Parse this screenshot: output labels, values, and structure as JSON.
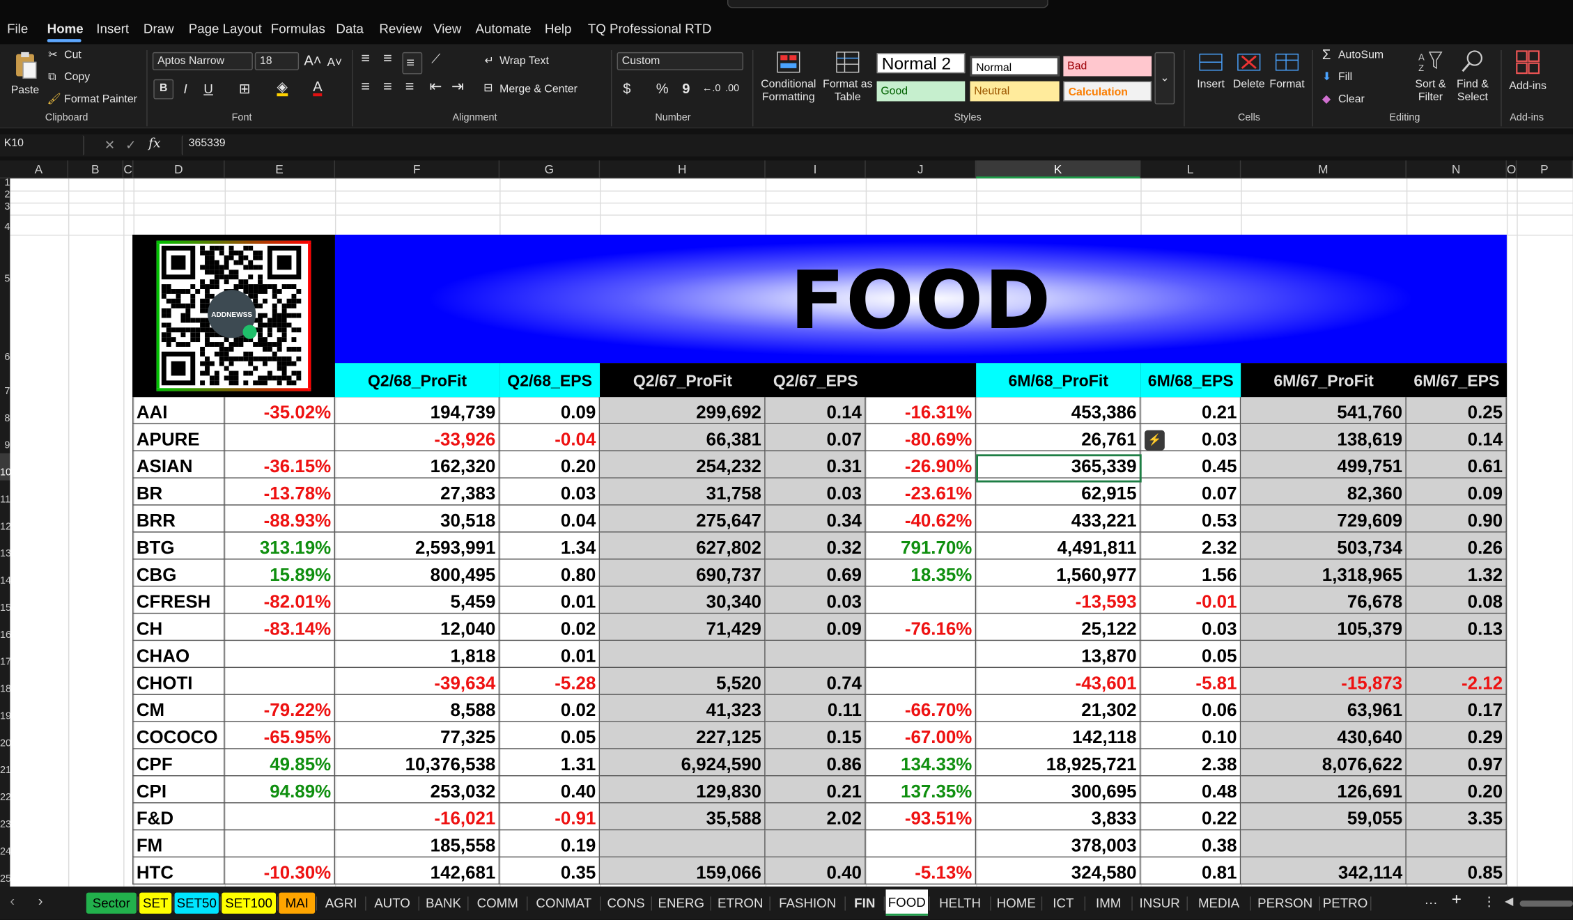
{
  "menu": [
    "File",
    "Home",
    "Insert",
    "Draw",
    "Page Layout",
    "Formulas",
    "Data",
    "Review",
    "View",
    "Automate",
    "Help",
    "TQ Professional RTD"
  ],
  "ribbon": {
    "clipboard": {
      "paste": "Paste",
      "cut": "Cut",
      "copy": "Copy",
      "format_painter": "Format Painter",
      "label": "Clipboard"
    },
    "font": {
      "name": "Aptos Narrow",
      "size": "18",
      "label": "Font",
      "bold": "B",
      "italic": "I",
      "underline": "U"
    },
    "alignment": {
      "wrap": "Wrap Text",
      "merge": "Merge & Center",
      "label": "Alignment"
    },
    "number": {
      "format": "Custom",
      "label": "Number",
      "currency": "$",
      "percent": "%",
      "comma": "9"
    },
    "styles": {
      "conditional": "Conditional\nFormatting",
      "format_table": "Format as\nTable",
      "normal2": "Normal 2",
      "normal": "Normal",
      "bad": "Bad",
      "good": "Good",
      "neutral": "Neutral",
      "calculation": "Calculation",
      "label": "Styles"
    },
    "cells": {
      "insert": "Insert",
      "delete": "Delete",
      "format": "Format",
      "label": "Cells"
    },
    "editing": {
      "autosum": "AutoSum",
      "fill": "Fill",
      "clear": "Clear",
      "sort": "Sort &\nFilter",
      "find": "Find &\nSelect",
      "label": "Editing"
    },
    "addins": {
      "addins": "Add-ins",
      "label": "Add-ins"
    }
  },
  "formula_bar": {
    "name_box": "K10",
    "fx": "fx",
    "value": "365339"
  },
  "columns": [
    "A",
    "B",
    "C",
    "D",
    "E",
    "F",
    "G",
    "H",
    "I",
    "J",
    "K",
    "L",
    "M",
    "N",
    "O",
    "P"
  ],
  "row_numbers": [
    "1",
    "2",
    "3",
    "4",
    "5",
    "6",
    "7",
    "8",
    "9",
    "10",
    "11",
    "12",
    "13",
    "14",
    "15",
    "16",
    "17",
    "18",
    "19",
    "20",
    "21",
    "22",
    "23",
    "24",
    "25"
  ],
  "sheet": {
    "title": "FOOD",
    "qr_logo": "ADDNEWSS",
    "headers": [
      "Q2/68_ProFit",
      "Q2/68_EPS",
      "Q2/67_ProFit",
      "Q2/67_EPS",
      "",
      "6M/68_ProFit",
      "6M/68_EPS",
      "6M/67_ProFit",
      "6M/67_EPS"
    ],
    "rows": [
      [
        "AAI",
        "-35.02%",
        "194,739",
        "0.09",
        "299,692",
        "0.14",
        "-16.31%",
        "453,386",
        "0.21",
        "541,760",
        "0.25"
      ],
      [
        "APURE",
        "",
        "-33,926",
        "-0.04",
        "66,381",
        "0.07",
        "-80.69%",
        "26,761",
        "0.03",
        "138,619",
        "0.14"
      ],
      [
        "ASIAN",
        "-36.15%",
        "162,320",
        "0.20",
        "254,232",
        "0.31",
        "-26.90%",
        "365,339",
        "0.45",
        "499,751",
        "0.61"
      ],
      [
        "BR",
        "-13.78%",
        "27,383",
        "0.03",
        "31,758",
        "0.03",
        "-23.61%",
        "62,915",
        "0.07",
        "82,360",
        "0.09"
      ],
      [
        "BRR",
        "-88.93%",
        "30,518",
        "0.04",
        "275,647",
        "0.34",
        "-40.62%",
        "433,221",
        "0.53",
        "729,609",
        "0.90"
      ],
      [
        "BTG",
        "313.19%",
        "2,593,991",
        "1.34",
        "627,802",
        "0.32",
        "791.70%",
        "4,491,811",
        "2.32",
        "503,734",
        "0.26"
      ],
      [
        "CBG",
        "15.89%",
        "800,495",
        "0.80",
        "690,737",
        "0.69",
        "18.35%",
        "1,560,977",
        "1.56",
        "1,318,965",
        "1.32"
      ],
      [
        "CFRESH",
        "-82.01%",
        "5,459",
        "0.01",
        "30,340",
        "0.03",
        "",
        "-13,593",
        "-0.01",
        "76,678",
        "0.08"
      ],
      [
        "CH",
        "-83.14%",
        "12,040",
        "0.02",
        "71,429",
        "0.09",
        "-76.16%",
        "25,122",
        "0.03",
        "105,379",
        "0.13"
      ],
      [
        "CHAO",
        "",
        "1,818",
        "0.01",
        "",
        "",
        "",
        "13,870",
        "0.05",
        "",
        ""
      ],
      [
        "CHOTI",
        "",
        "-39,634",
        "-5.28",
        "5,520",
        "0.74",
        "",
        "-43,601",
        "-5.81",
        "-15,873",
        "-2.12"
      ],
      [
        "CM",
        "-79.22%",
        "8,588",
        "0.02",
        "41,323",
        "0.11",
        "-66.70%",
        "21,302",
        "0.06",
        "63,961",
        "0.17"
      ],
      [
        "COCOCO",
        "-65.95%",
        "77,325",
        "0.05",
        "227,125",
        "0.15",
        "-67.00%",
        "142,118",
        "0.10",
        "430,640",
        "0.29"
      ],
      [
        "CPF",
        "49.85%",
        "10,376,538",
        "1.31",
        "6,924,590",
        "0.86",
        "134.33%",
        "18,925,721",
        "2.38",
        "8,076,622",
        "0.97"
      ],
      [
        "CPI",
        "94.89%",
        "253,032",
        "0.40",
        "129,830",
        "0.21",
        "137.35%",
        "300,695",
        "0.48",
        "126,691",
        "0.20"
      ],
      [
        "F&D",
        "",
        "-16,021",
        "-0.91",
        "35,588",
        "2.02",
        "-93.51%",
        "3,833",
        "0.22",
        "59,055",
        "3.35"
      ],
      [
        "FM",
        "",
        "185,558",
        "0.19",
        "",
        "",
        "",
        "378,003",
        "0.38",
        "",
        ""
      ],
      [
        "HTC",
        "-10.30%",
        "142,681",
        "0.35",
        "159,066",
        "0.40",
        "-5.13%",
        "324,580",
        "0.81",
        "342,114",
        "0.85"
      ]
    ]
  },
  "tabs": [
    {
      "label": "Sector",
      "color": "#22b14c"
    },
    {
      "label": "SET",
      "color": "#ffff00"
    },
    {
      "label": "SET50",
      "color": "#00e5ff"
    },
    {
      "label": "SET100",
      "color": "#ffff00"
    },
    {
      "label": "MAI",
      "color": "#ffa500"
    },
    {
      "label": "AGRI"
    },
    {
      "label": "AUTO"
    },
    {
      "label": "BANK"
    },
    {
      "label": "COMM"
    },
    {
      "label": "CONMAT"
    },
    {
      "label": "CONS"
    },
    {
      "label": "ENERG"
    },
    {
      "label": "ETRON"
    },
    {
      "label": "FASHION"
    },
    {
      "label": "FIN",
      "bold": true
    },
    {
      "label": "FOOD",
      "active": true
    },
    {
      "label": "HELTH"
    },
    {
      "label": "HOME"
    },
    {
      "label": "ICT"
    },
    {
      "label": "IMM"
    },
    {
      "label": "INSUR"
    },
    {
      "label": "MEDIA"
    },
    {
      "label": "PERSON"
    },
    {
      "label": "PETRO"
    }
  ],
  "tab_more": "···",
  "tab_add": "+",
  "colors": {
    "accent": "#5ea8ff",
    "cyan_header": "#00ffff",
    "banner_blue": "#0000ff",
    "negative": "#ee1111",
    "positive": "#0f8f0f",
    "gray_block": "#d1d1d1"
  }
}
